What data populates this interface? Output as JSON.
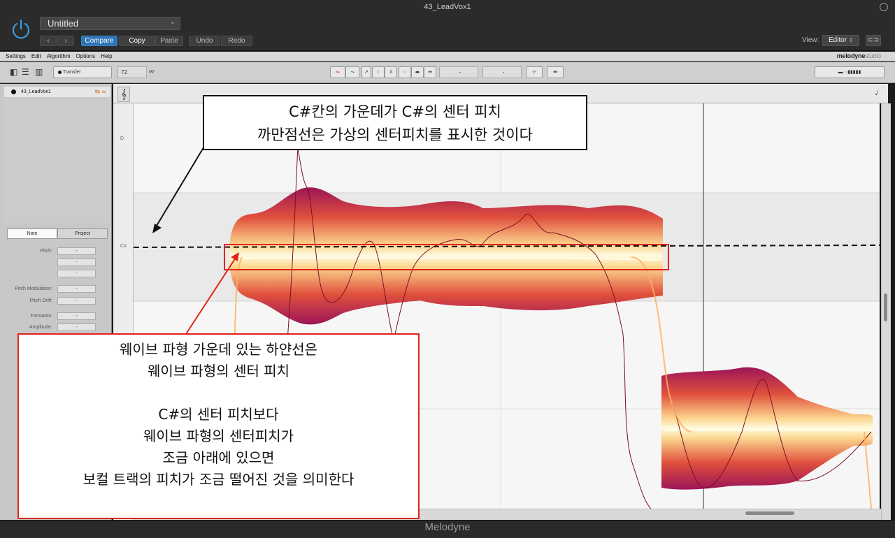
{
  "window": {
    "title": "43_LeadVox1"
  },
  "header": {
    "preset": "Untitled",
    "compare_label": "Compare",
    "copy_label": "Copy",
    "paste_label": "Paste",
    "undo_label": "Undo",
    "redo_label": "Redo",
    "view_label": "View:",
    "view_value": "Editor"
  },
  "menu": {
    "items": [
      "Settings",
      "Edit",
      "Algorithm",
      "Options",
      "Help"
    ],
    "brand": "melodyne",
    "brand_edition": "studio"
  },
  "toolbar": {
    "transfer_label": "Transfer",
    "tempo_value": "72",
    "field_a": "-",
    "field_b": "-"
  },
  "left_panel": {
    "track_name": "43_LeadVox1",
    "tabs": [
      "Note",
      "Project"
    ],
    "properties": {
      "pitch_label": "Pitch:",
      "pitch_modulation_label": "Pitch Modulation:",
      "pitch_drift_label": "Pitch Drift:",
      "formants_label": "Formants:",
      "amplitude_label": "Amplitude:",
      "empty_value": "-"
    }
  },
  "editor": {
    "pitch_labels": [
      "D",
      "C#"
    ],
    "colors": {
      "blob_outer": "#9c1558",
      "blob_mid": "#e65a3e",
      "blob_inner": "#fff6c8",
      "highlight": "#e0241c"
    }
  },
  "annotations": {
    "top": {
      "line1": "C#칸의 가운데가 C#의 센터 피치",
      "line2": "까만점선은 가상의 센터피치를 표시한 것이다"
    },
    "bottom": {
      "line1": "웨이브 파형 가운데 있는 하얀선은",
      "line2": "웨이브 파형의 센터 피치",
      "line3": "C#의 센터 피치보다",
      "line4": "웨이브 파형의 센터피치가",
      "line5": "조금 아래에 있으면",
      "line6": "보컬 트랙의 피치가 조금 떨어진 것을 의미한다"
    }
  },
  "footer": {
    "title": "Melodyne"
  }
}
